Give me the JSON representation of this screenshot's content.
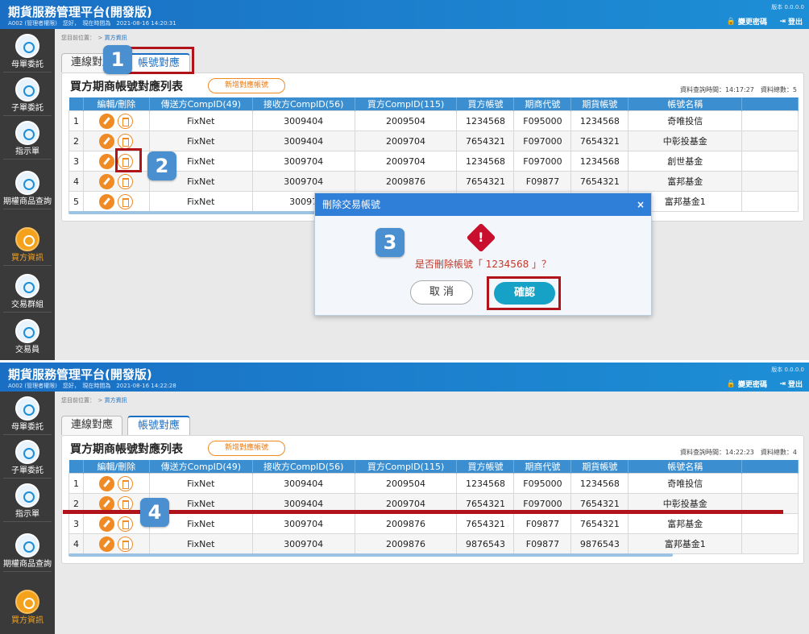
{
  "header": {
    "title": "期貨服務管理平台(開發版)",
    "user": "A002 (管理者權限)　您好，　現在時間為",
    "time_1": "2021-08-16 14:20:31",
    "time_2": "2021-08-16 14:22:28",
    "version": "版本 0.0.0.0",
    "change_password": "變更密碼",
    "logout": "登出",
    "bar_color": "#1a6fc4"
  },
  "sidebar": {
    "items": [
      {
        "label": "母單委託",
        "icon": "order-icon"
      },
      {
        "label": "子單委託",
        "icon": "sub-order-icon"
      },
      {
        "label": "指示單",
        "icon": "instruction-icon"
      },
      {
        "label": "期權商品查詢",
        "icon": "search-icon"
      },
      {
        "label": "買方資訊",
        "icon": "money-bag-icon",
        "active": true
      },
      {
        "label": "交易群組",
        "icon": "group-icon"
      },
      {
        "label": "交易員",
        "icon": "trader-icon"
      }
    ],
    "active_color": "#f4a11c"
  },
  "breadcrumb": {
    "prefix": "您目前位置：　>",
    "current": "買方資訊"
  },
  "tabs": [
    {
      "label": "連線對應"
    },
    {
      "label": "帳號對應",
      "selected": true
    }
  ],
  "list": {
    "title": "買方期商帳號對應列表",
    "add_button": "新增對應帳號",
    "meta_1": "資料查詢時間：14:17:27　資料總數：5",
    "meta_2": "資料查詢時間：14:22:23　資料總數：4",
    "columns": [
      "",
      "編輯/刪除",
      "傳送方CompID(49)",
      "接收方CompID(56)",
      "買方CompID(115)",
      "買方帳號",
      "期商代號",
      "期貨帳號",
      "帳號名稱"
    ],
    "rows_before": [
      [
        "1",
        "FixNet",
        "3009404",
        "2009504",
        "1234568",
        "F095000",
        "1234568",
        "奇唯投信"
      ],
      [
        "2",
        "FixNet",
        "3009404",
        "2009704",
        "7654321",
        "F097000",
        "7654321",
        "中彰投基金"
      ],
      [
        "3",
        "FixNet",
        "3009704",
        "2009704",
        "1234568",
        "F097000",
        "1234568",
        "創世基金"
      ],
      [
        "4",
        "FixNet",
        "3009704",
        "2009876",
        "7654321",
        "F09877",
        "7654321",
        "富邦基金"
      ],
      [
        "5",
        "FixNet",
        "30097",
        "",
        "",
        "",
        "",
        "富邦基金1"
      ]
    ],
    "rows_after": [
      [
        "1",
        "FixNet",
        "3009404",
        "2009504",
        "1234568",
        "F095000",
        "1234568",
        "奇唯投信"
      ],
      [
        "2",
        "FixNet",
        "3009404",
        "2009704",
        "7654321",
        "F097000",
        "7654321",
        "中彰投基金"
      ],
      [
        "3",
        "FixNet",
        "3009704",
        "2009876",
        "7654321",
        "F09877",
        "7654321",
        "富邦基金"
      ],
      [
        "4",
        "FixNet",
        "3009704",
        "2009876",
        "9876543",
        "F09877",
        "9876543",
        "富邦基金1"
      ]
    ]
  },
  "dialog": {
    "title": "刪除交易帳號",
    "close": "×",
    "warning": "!",
    "message": "是否刪除帳號「 1234568 」？",
    "cancel": "取 消",
    "confirm": "確認"
  },
  "steps": [
    "1",
    "2",
    "3",
    "4"
  ],
  "highlight_color": "#b0141a"
}
